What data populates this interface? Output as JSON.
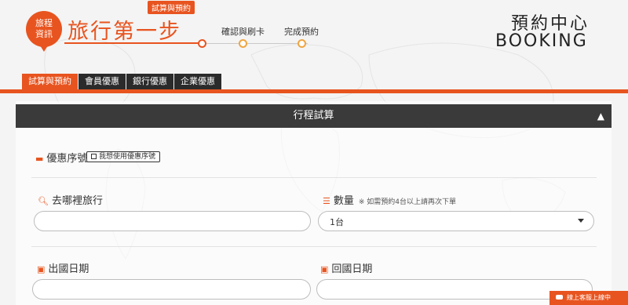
{
  "header": {
    "info_bubble": "旅程\n資訊",
    "step_badge": "試算與預約",
    "step_title": "旅行第一步",
    "steps": [
      {
        "label": "確認與刷卡"
      },
      {
        "label": "完成預約"
      }
    ],
    "booking_title": "預約中心",
    "booking_sub": "BOOKING"
  },
  "tabs": [
    {
      "label": "試算與預約",
      "active": true
    },
    {
      "label": "會員優惠",
      "active": false
    },
    {
      "label": "銀行優惠",
      "active": false
    },
    {
      "label": "企業優惠",
      "active": false
    }
  ],
  "panel": {
    "title": "行程試算",
    "coupon_label": "優惠序號",
    "coupon_button": "我想使用優惠序號",
    "destination_label": "去哪裡旅行",
    "destination_value": "",
    "quantity_label": "數量",
    "quantity_note": "※ 如需預約4台以上請再次下單",
    "quantity_value": "1台",
    "depart_label": "出國日期",
    "return_label": "回國日期"
  },
  "chat": {
    "label": "線上客服上線中"
  },
  "colors": {
    "accent": "#e8541f",
    "dark": "#2b2b2b",
    "dot": "#f0a541"
  }
}
